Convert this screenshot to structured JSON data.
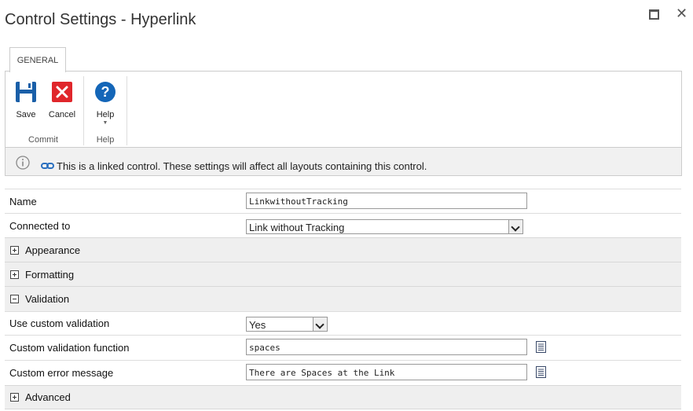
{
  "window": {
    "title": "Control Settings - Hyperlink"
  },
  "tabs": [
    {
      "label": "GENERAL"
    }
  ],
  "ribbon": {
    "groups": [
      {
        "label": "Commit",
        "buttons": [
          {
            "label": "Save",
            "icon": "save-icon"
          },
          {
            "label": "Cancel",
            "icon": "cancel-icon"
          }
        ]
      },
      {
        "label": "Help",
        "buttons": [
          {
            "label": "Help",
            "icon": "help-icon"
          }
        ]
      }
    ]
  },
  "info": {
    "text": "This is a linked control. These settings will affect all layouts containing this control.",
    "icon": "info-icon",
    "link_icon": "link-icon"
  },
  "fields": {
    "name": {
      "label": "Name",
      "value": "LinkwithoutTracking"
    },
    "connected_to": {
      "label": "Connected to",
      "value": "Link without Tracking"
    }
  },
  "sections": {
    "appearance": "Appearance",
    "formatting": "Formatting",
    "validation": "Validation",
    "advanced": "Advanced"
  },
  "validation": {
    "use_custom": {
      "label": "Use custom validation",
      "value": "Yes"
    },
    "function": {
      "label": "Custom validation function",
      "value": "spaces"
    },
    "error": {
      "label": "Custom error message",
      "value": "There are Spaces at the Link"
    }
  },
  "colors": {
    "save_blue": "#1a5fa8",
    "cancel_red": "#e0262b",
    "help_blue": "#1466b8",
    "link_blue": "#2a6fbf"
  }
}
